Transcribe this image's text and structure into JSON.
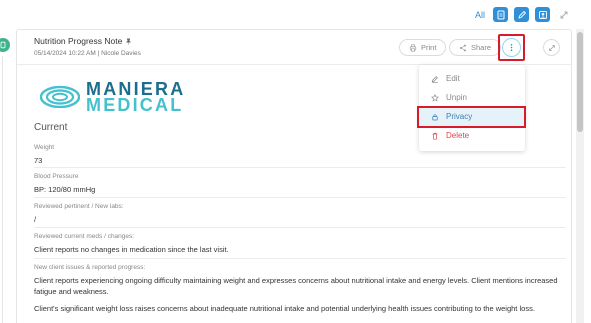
{
  "filter_bar": {
    "all_label": "All",
    "buttons": [
      {
        "icon": "document-icon"
      },
      {
        "icon": "pencil-icon"
      },
      {
        "icon": "user-icon"
      },
      {
        "icon": "collapse-icon"
      }
    ]
  },
  "note": {
    "title": "Nutrition Progress Note",
    "meta": "05/14/2024 10:22 AM | Nicole Davies",
    "print_label": "Print",
    "share_label": "Share",
    "logo": {
      "line1": "MANIERA",
      "line2": "MEDICAL"
    },
    "section_title": "Current",
    "fields": [
      {
        "label": "Weight",
        "value": "73"
      },
      {
        "label": "Blood Pressure",
        "value": "BP: 120/80 mmHg"
      },
      {
        "label": "Reviewed pertinent / New labs:",
        "value": "/"
      },
      {
        "label": "Reviewed current meds / changes:",
        "value": "Client reports no changes in medication since the last visit."
      },
      {
        "label": "New client issues & reported progress:",
        "value": "Client reports experiencing ongoing difficulty maintaining weight and expresses concerns about nutritional intake and energy levels. Client mentions increased fatigue and weakness."
      }
    ],
    "paragraph": "Client's significant weight loss raises concerns about inadequate nutritional intake and potential underlying health issues contributing to the weight loss."
  },
  "menu": {
    "items": [
      {
        "label": "Edit",
        "icon": "edit-icon"
      },
      {
        "label": "Unpin",
        "icon": "pin-icon"
      },
      {
        "label": "Privacy",
        "icon": "lock-icon"
      },
      {
        "label": "Delete",
        "icon": "trash-icon"
      }
    ]
  },
  "colors": {
    "accent": "#2f8fd8",
    "highlight": "#d81b2b",
    "delete": "#e0454e",
    "logo_dark": "#1c6e8e",
    "logo_light": "#45c0cf"
  }
}
